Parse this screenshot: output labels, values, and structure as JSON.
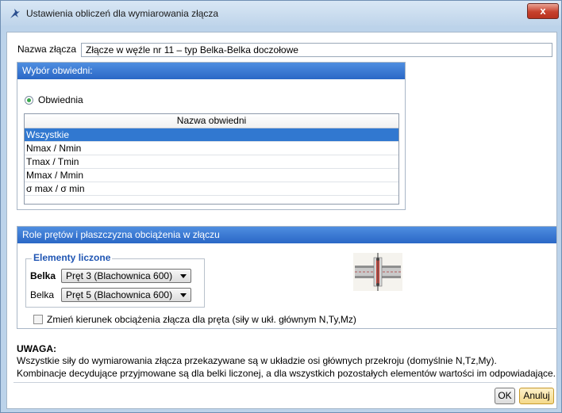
{
  "window": {
    "title": "Ustawienia obliczeń dla wymiarowania złącza",
    "close_glyph": "x"
  },
  "name_field": {
    "label": "Nazwa złącza",
    "value": "Złącze w węźle nr 11 – typ Belka-Belka doczołowe"
  },
  "envelope_group": {
    "title": "Wybór obwiedni:",
    "radio_label": "Obwiednia",
    "list_header": "Nazwa obwiedni",
    "items": [
      "Wszystkie",
      "Nmax / Nmin",
      "Tmax / Tmin",
      "Mmax / Mmin",
      "σ max / σ min"
    ],
    "selected_index": 0
  },
  "roles_group": {
    "title": "Role prętów i płaszczyzna obciążenia w złączu",
    "fieldset_legend": "Elementy liczone",
    "rows": [
      {
        "label": "Belka",
        "value": "Pręt 3 (Blachownica 600)",
        "bold": true
      },
      {
        "label": "Belka",
        "value": "Pręt 5 (Blachownica 600)",
        "bold": false
      }
    ],
    "checkbox_label": "Zmień kierunek obciążenia złącza dla pręta (siły w ukł. głównym N,Ty,Mz)",
    "checkbox_checked": false
  },
  "note": {
    "title": "UWAGA:",
    "line1": "Wszystkie siły do wymiarowania złącza przekazywane są w układzie osi głównych przekroju (domyślnie N,Tz,My).",
    "line2": "Kombinacje decydujące przyjmowane są dla belki liczonej, a dla wszystkich pozostałych elementów wartości im odpowiadające."
  },
  "buttons": {
    "ok": "OK",
    "cancel": "Anuluj"
  },
  "colors": {
    "group_header": "#2f6fcf",
    "selection": "#3178d0",
    "radio_dot": "#3aa84d",
    "legend_text": "#1f55b3"
  },
  "icons": [
    "app-icon",
    "close-icon",
    "radio-icon",
    "dropdown-arrow-icon",
    "checkbox-icon",
    "joint-preview-icon"
  ]
}
